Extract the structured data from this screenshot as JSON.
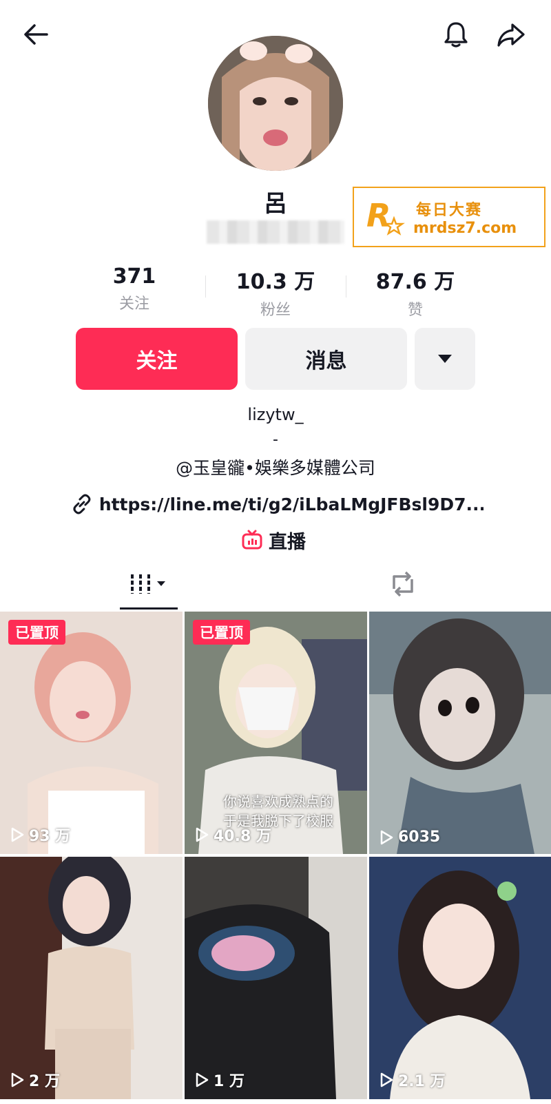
{
  "topbar": {
    "back_icon": "arrow-left-icon",
    "bell_icon": "bell-icon",
    "share_icon": "share-arrow-icon"
  },
  "profile": {
    "name": "呂",
    "stats": [
      {
        "value": "371",
        "label": "关注"
      },
      {
        "value": "10.3 万",
        "label": "粉丝"
      },
      {
        "value": "87.6 万",
        "label": "赞"
      }
    ]
  },
  "watermark": {
    "title": "每日大赛",
    "url": "mrdsz7.com",
    "logo_text": "每日大赛"
  },
  "actions": {
    "follow_label": "关注",
    "message_label": "消息",
    "more_icon": "caret-down-icon"
  },
  "bio": {
    "line1": "lizytw_",
    "line2": "-",
    "line3": "@玉皇豅•娛樂多媒體公司",
    "link": "https://line.me/ti/g2/iLbaLMgJFBsl9D7...",
    "live_label": "直播"
  },
  "tabs": {
    "videos_icon": "grid-columns-icon",
    "reposts_icon": "repost-icon"
  },
  "videos": [
    {
      "views": "93 万",
      "pinned": "已置顶"
    },
    {
      "views": "40.8 万",
      "pinned": "已置顶",
      "caption1": "你说喜欢成熟点的",
      "caption2": "于是我脱下了校服"
    },
    {
      "views": "6035"
    },
    {
      "views": "2 万"
    },
    {
      "views": "1 万"
    },
    {
      "views": "2.1 万"
    }
  ],
  "colors": {
    "accent": "#fe2c55",
    "secondary_bg": "#f1f1f2",
    "watermark": "#e8900c"
  }
}
